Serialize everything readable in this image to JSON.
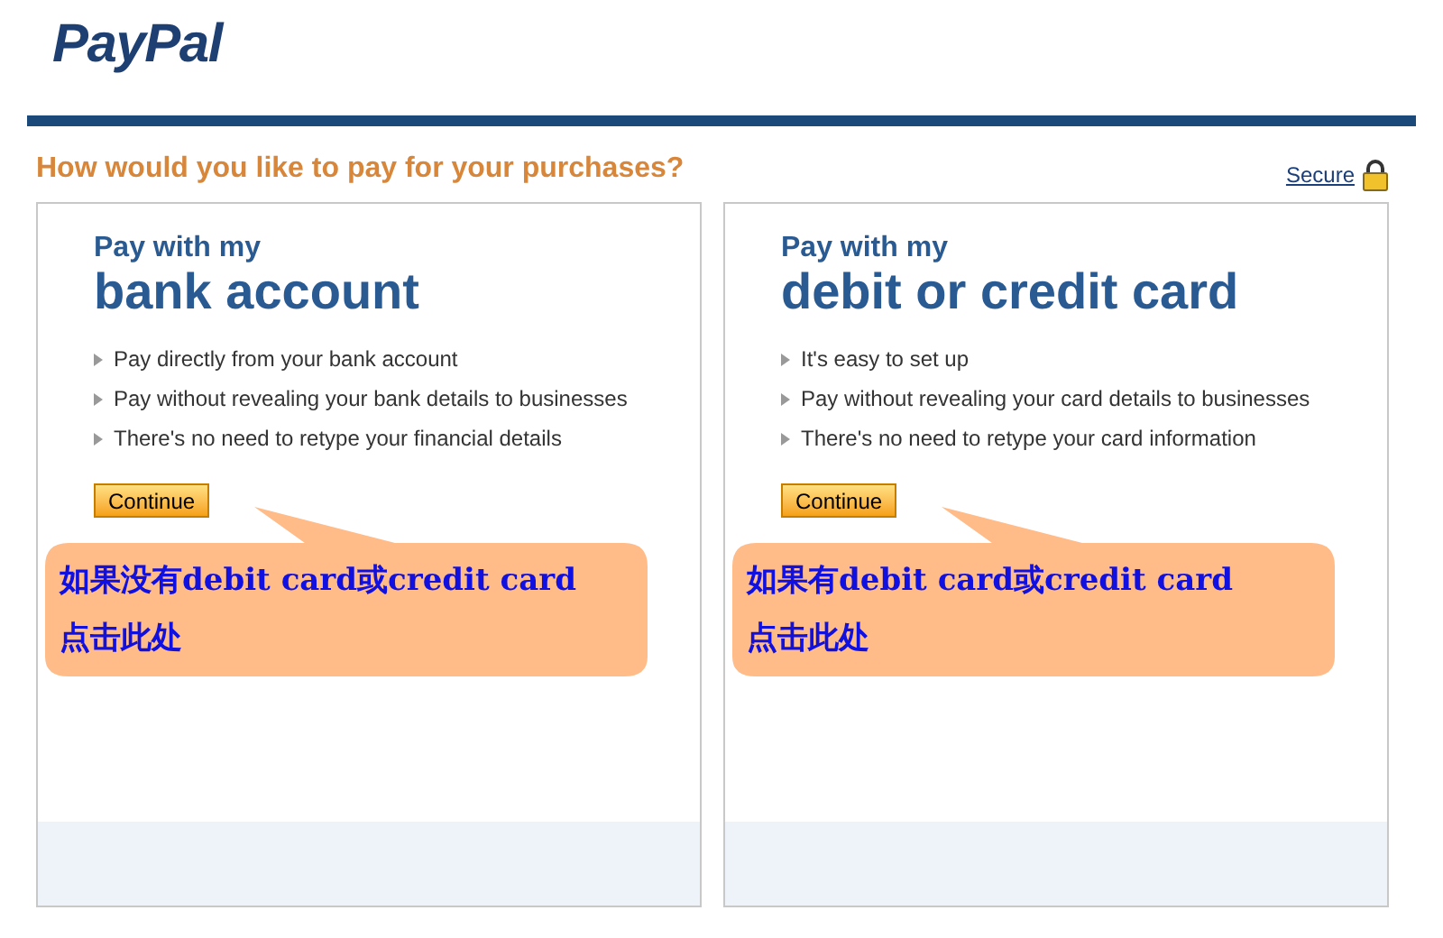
{
  "logo": "PayPal",
  "heading": "How would you like to pay for your purchases?",
  "secure_link": "Secure",
  "options": [
    {
      "intro": "Pay with my",
      "title": "bank account",
      "bullets": [
        "Pay directly from your bank account",
        "Pay without revealing your bank details to businesses",
        "There's no need to retype your financial details"
      ],
      "button": "Continue",
      "callout": [
        "如果没有debit card或credit card",
        "点击此处"
      ]
    },
    {
      "intro": "Pay with my",
      "title": "debit or credit card",
      "bullets": [
        "It's easy to set up",
        "Pay without revealing your card details to businesses",
        "There's no need to retype your card information"
      ],
      "button": "Continue",
      "callout": [
        "如果有debit card或credit card",
        "点击此处"
      ]
    }
  ]
}
